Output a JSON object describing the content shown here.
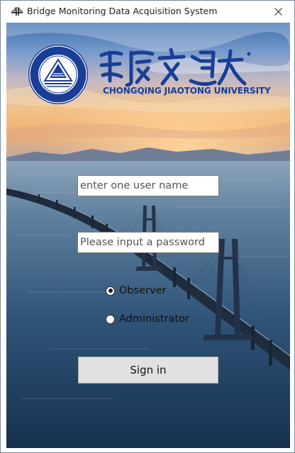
{
  "window": {
    "title": "Bridge Monitoring Data Acquisition System",
    "app_icon": "bridge-icon",
    "close_icon": "close-icon"
  },
  "branding": {
    "university_name_cn": "重庆交通大学",
    "university_name_en": "CHONGQING JIAOTONG UNIVERSITY",
    "emblem_ring_text": "CHONGQING JIAOTONG UNIVERSITY",
    "emblem_year": "1951",
    "brand_color": "#1a3e96"
  },
  "login": {
    "username": {
      "value": "",
      "placeholder": "enter one user name"
    },
    "password": {
      "value": "",
      "placeholder": "Please input a password"
    },
    "roles": [
      {
        "label": "Observer",
        "selected": true
      },
      {
        "label": "Administrator",
        "selected": false
      }
    ],
    "submit_label": "Sign in"
  }
}
